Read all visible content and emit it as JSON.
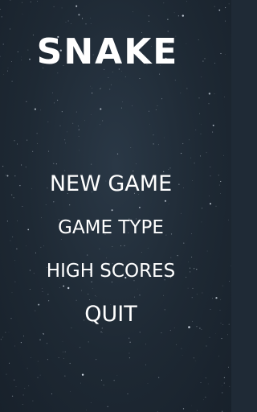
{
  "game": {
    "title": "SNAKE",
    "background": "starfield",
    "colors": {
      "background": "#1f2a36",
      "text": "#ffffff",
      "stars": "#cfd8e3"
    }
  },
  "menu": {
    "items": [
      {
        "label": "NEW GAME"
      },
      {
        "label": "GAME TYPE"
      },
      {
        "label": "HIGH SCORES"
      },
      {
        "label": "QUIT"
      }
    ]
  }
}
